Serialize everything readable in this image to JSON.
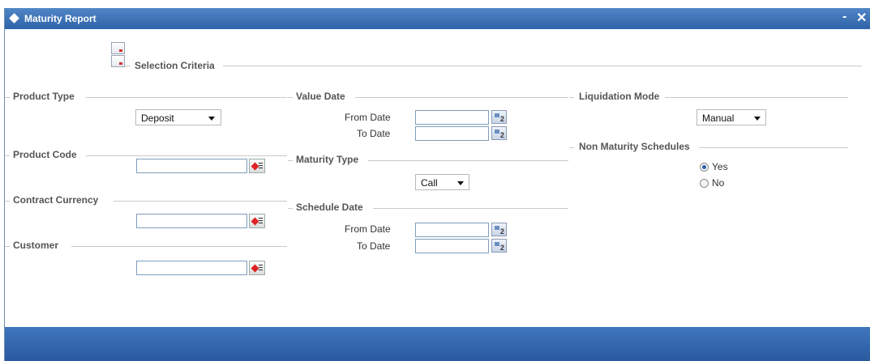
{
  "window": {
    "title": "Maturity Report",
    "controls": {
      "minimize": "-",
      "close": "✕"
    }
  },
  "selection_criteria": {
    "title": "Selection Criteria"
  },
  "product_type": {
    "label": "Product Type",
    "value": "Deposit"
  },
  "product_code": {
    "label": "Product Code",
    "value": ""
  },
  "contract_currency": {
    "label": "Contract Currency",
    "value": ""
  },
  "customer": {
    "label": "Customer",
    "value": ""
  },
  "value_date": {
    "label": "Value Date",
    "from_label": "From Date",
    "to_label": "To Date",
    "from_value": "",
    "to_value": ""
  },
  "maturity_type": {
    "label": "Maturity Type",
    "value": "Call"
  },
  "schedule_date": {
    "label": "Schedule Date",
    "from_label": "From Date",
    "to_label": "To Date",
    "from_value": "",
    "to_value": ""
  },
  "liquidation_mode": {
    "label": "Liquidation Mode",
    "value": "Manual"
  },
  "non_maturity_schedules": {
    "label": "Non Maturity Schedules",
    "options": [
      {
        "label": "Yes",
        "selected": true
      },
      {
        "label": "No",
        "selected": false
      }
    ]
  },
  "colors": {
    "titlebar": "#3a6fb5",
    "footer": "#3a6fb5",
    "section_label": "#555555"
  },
  "icons": {
    "lov": "lov-search-icon",
    "calendar": "calendar-icon",
    "title": "diamond-icon"
  }
}
